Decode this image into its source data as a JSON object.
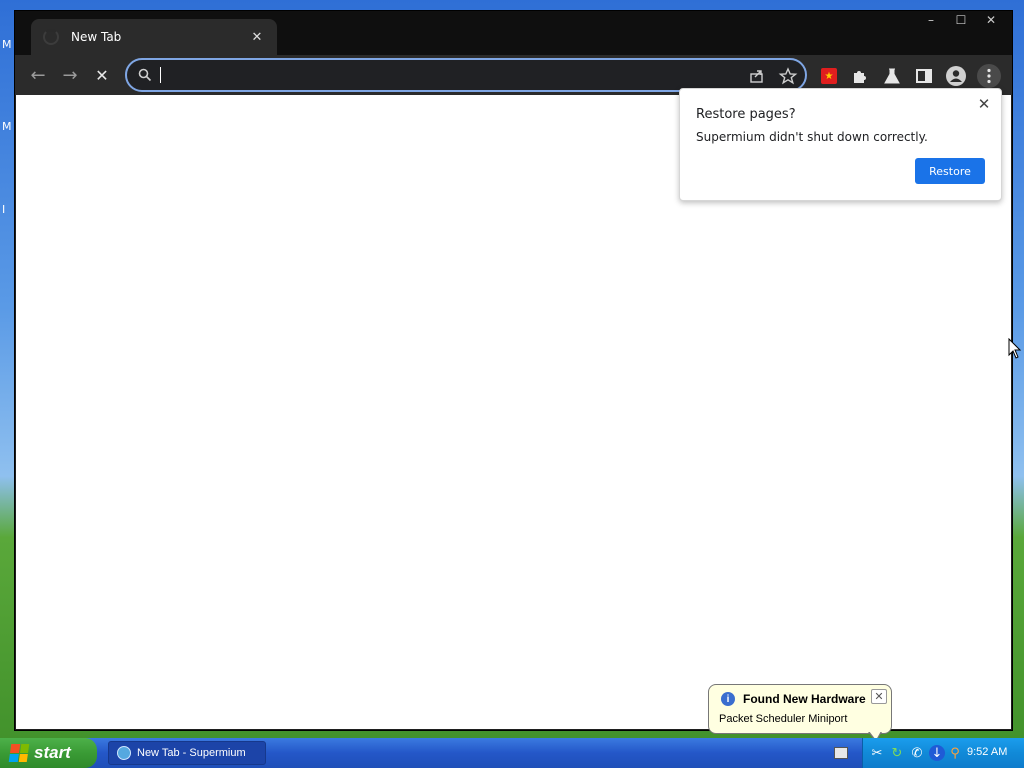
{
  "desktop": {
    "hints": [
      "M",
      "M",
      "I"
    ]
  },
  "browser": {
    "tab": {
      "title": "New Tab",
      "close_icon": "close-icon"
    },
    "window_controls": {
      "minimize": "–",
      "maximize": "☐",
      "close": "✕"
    },
    "toolbar": {
      "back": "←",
      "forward": "→",
      "stop": "✕",
      "omnibox_value": "",
      "omnibox_placeholder": ""
    },
    "popup": {
      "title": "Restore pages?",
      "message": "Supermium didn't shut down correctly.",
      "restore_label": "Restore",
      "close": "✕"
    }
  },
  "notification": {
    "title": "Found New Hardware",
    "text": "Packet Scheduler Miniport",
    "icon": "i",
    "close": "✕"
  },
  "taskbar": {
    "start_label": "start",
    "task_item_label": "New Tab - Supermium",
    "clock": "9:52 AM"
  },
  "colors": {
    "accent": "#1a73e8",
    "start_green": "#3a9b35",
    "taskbar_blue": "#2457c8",
    "balloon_bg": "#ffffe1"
  }
}
